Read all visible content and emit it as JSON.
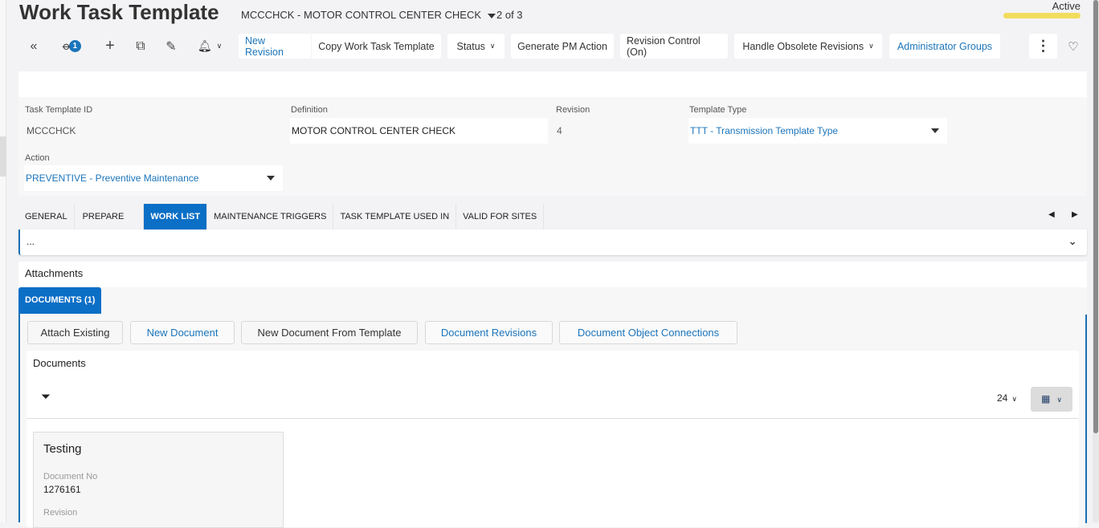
{
  "header": {
    "title": "Work Task Template",
    "record": "MCCCHCK - MOTOR CONTROL CENTER CHECK",
    "pager": "2 of 3",
    "status": "Active",
    "status_color": "#f2dc5d"
  },
  "toolbar": {
    "attachment_count": "1",
    "new_revision": "New Revision",
    "copy": "Copy Work Task Template",
    "status": "Status",
    "generate_pm": "Generate PM Action",
    "revision_control": "Revision Control (On)",
    "handle_obsolete": "Handle Obsolete Revisions",
    "admin_groups": "Administrator Groups"
  },
  "form": {
    "task_template_id": {
      "label": "Task Template ID",
      "value": "MCCCHCK"
    },
    "definition": {
      "label": "Definition",
      "value": "MOTOR CONTROL CENTER CHECK"
    },
    "revision": {
      "label": "Revision",
      "value": "4"
    },
    "template_type": {
      "label": "Template Type",
      "value": "TTT - Transmission Template Type"
    },
    "action": {
      "label": "Action",
      "value": "PREVENTIVE - Preventive Maintenance"
    }
  },
  "tabs": [
    "GENERAL",
    "PREPARE",
    "WORK LIST",
    "MAINTENANCE TRIGGERS",
    "TASK TEMPLATE USED IN",
    "VALID FOR SITES"
  ],
  "collapsed_text": "...",
  "attachments": {
    "title": "Attachments",
    "tab": "DOCUMENTS (1)",
    "buttons": [
      "Attach Existing",
      "New Document",
      "New Document From Template",
      "Document Revisions",
      "Document Object Connections"
    ],
    "documents_title": "Documents",
    "page_size": "24",
    "card": {
      "title": "Testing",
      "doc_no_label": "Document No",
      "doc_no": "1276161",
      "revision_label": "Revision"
    }
  },
  "accent": "#0b6fc6"
}
